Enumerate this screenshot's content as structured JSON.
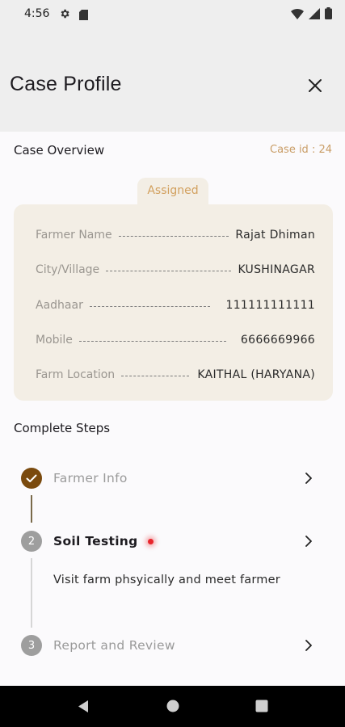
{
  "status_bar": {
    "time": "4:56"
  },
  "header": {
    "title": "Case Profile"
  },
  "overview": {
    "title": "Case Overview",
    "case_id": "Case id : 24",
    "status": "Assigned",
    "fields": [
      {
        "label": "Farmer Name",
        "value": "Rajat Dhiman"
      },
      {
        "label": "City/Village",
        "value": "KUSHINAGAR"
      },
      {
        "label": "Aadhaar",
        "value": "111111111111"
      },
      {
        "label": "Mobile",
        "value": "6666669966"
      },
      {
        "label": "Farm Location",
        "value": "KAITHAL (HARYANA)"
      }
    ]
  },
  "steps": {
    "title": "Complete Steps",
    "items": [
      {
        "number": "1",
        "label": "Farmer Info",
        "state": "done"
      },
      {
        "number": "2",
        "label": "Soil Testing",
        "state": "active",
        "description": "Visit farm phsyically and meet farmer"
      },
      {
        "number": "3",
        "label": "Report and Review",
        "state": "pending"
      }
    ]
  },
  "colors": {
    "accent": "#7a4a0e",
    "card_bg": "#f3eee5",
    "tab_text": "#d2a05e",
    "pending": "#9e9e9e",
    "alert_dot": "#e8252c"
  }
}
